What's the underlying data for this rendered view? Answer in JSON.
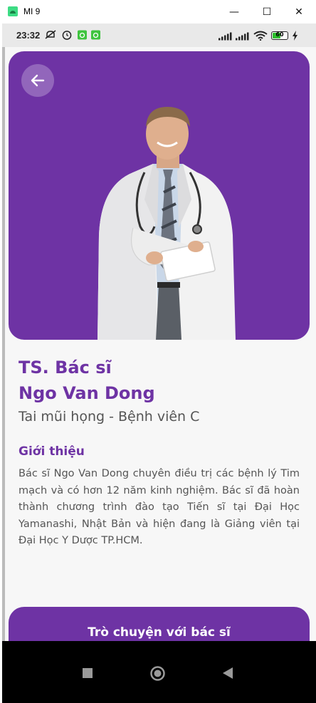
{
  "window": {
    "title": "MI 9",
    "minimize": "—",
    "maximize": "☐",
    "close": "✕"
  },
  "status_bar": {
    "time": "23:32",
    "battery_level": "60",
    "battery_fraction": 0.6
  },
  "doctor": {
    "title_line1": "TS. Bác sĩ",
    "title_line2": "Ngo Van Dong",
    "specialty": "Tai mũi họng - Bệnh viên C"
  },
  "intro": {
    "heading": "Giới thiệu",
    "body": "Bác sĩ Ngo Van Dong chuyên điều trị các bệnh lý Tim mạch và có hơn 12 năm kinh nghiệm. Bác sĩ đã hoàn thành chương trình đào tạo Tiến sĩ tại Đại Học Yamanashi, Nhật Bản và hiện đang là Giảng viên tại Đại Học Y Dược TP.HCM."
  },
  "actions": {
    "chat_label": "Trò chuyện với bác sĩ"
  },
  "colors": {
    "primary": "#6e33a4",
    "text_secondary": "#555555"
  },
  "icons": {
    "back": "arrow-left-icon",
    "nav": [
      "square-icon",
      "circle-icon",
      "triangle-back-icon"
    ]
  }
}
